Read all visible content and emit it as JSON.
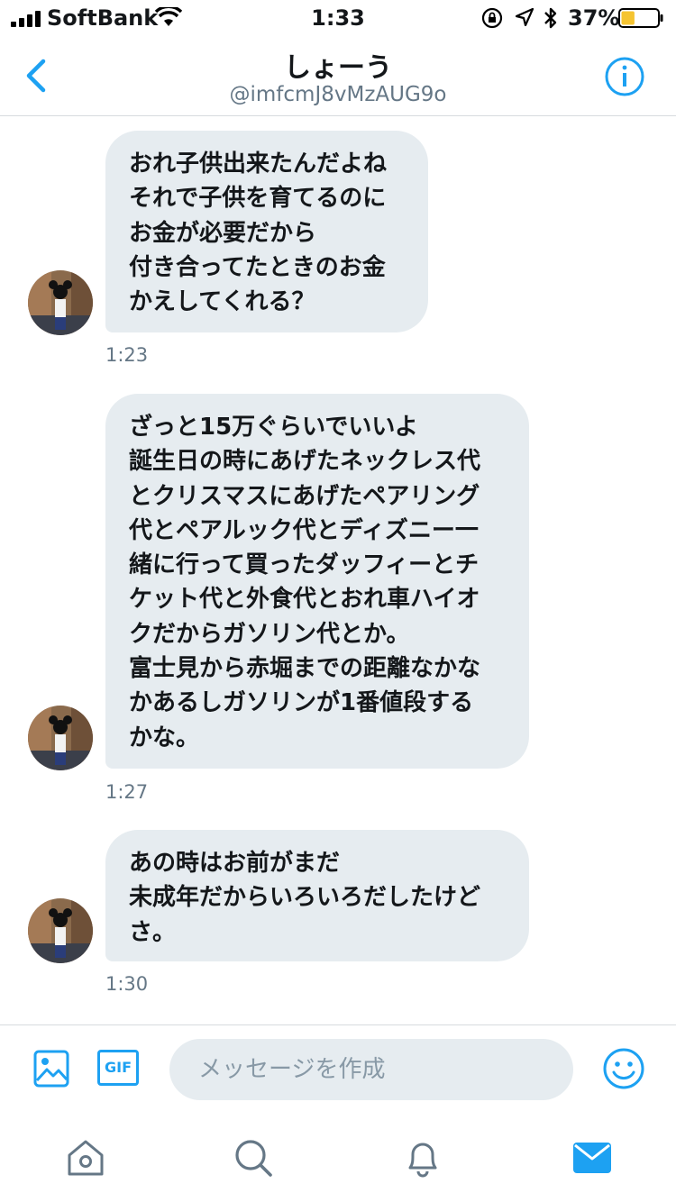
{
  "status_bar": {
    "carrier": "SoftBank",
    "time": "1:33",
    "battery_percent": "37%",
    "battery_level": 0.37,
    "icons": [
      "signal-icon",
      "wifi-icon",
      "rotation-lock-icon",
      "location-icon",
      "bluetooth-icon",
      "battery-icon"
    ]
  },
  "header": {
    "title": "しょーう",
    "handle": "@imfcmJ8vMzAUG9o",
    "back_icon": "chevron-left-icon",
    "info_icon": "info-icon"
  },
  "messages": [
    {
      "text": "おれ子供出来たんだよね\nそれで子供を育てるのに\nお金が必要だから\n付き合ってたときのお金\nかえしてくれる？",
      "time": "1:23"
    },
    {
      "text": "ざっと15万ぐらいでいいよ\n誕生日の時にあげたネックレス代\nとクリスマスにあげたペアリング\n代とペアルック代とディズニー一\n緒に行って買ったダッフィーとチ\nケット代と外食代とおれ車ハイオ\nクだからガソリン代とか。\n富士見から赤堀までの距離なかな\nかあるしガソリンが1番値段する\nかな。",
      "time": "1:27"
    },
    {
      "text": "あの時はお前がまだ\n未成年だからいろいろだしたけど\nさ。",
      "time": "1:30"
    }
  ],
  "compose": {
    "placeholder": "メッセージを作成",
    "gif_label": "GIF",
    "image_icon": "image-icon",
    "emoji_icon": "emoji-icon"
  },
  "tabbar": {
    "items": [
      "home-icon",
      "search-icon",
      "notifications-icon",
      "messages-icon"
    ],
    "active": "messages-icon"
  },
  "colors": {
    "accent": "#1da1f2",
    "bubble": "#e6ecf0",
    "secondary_text": "#657786",
    "battery_fill": "#f5c431"
  }
}
